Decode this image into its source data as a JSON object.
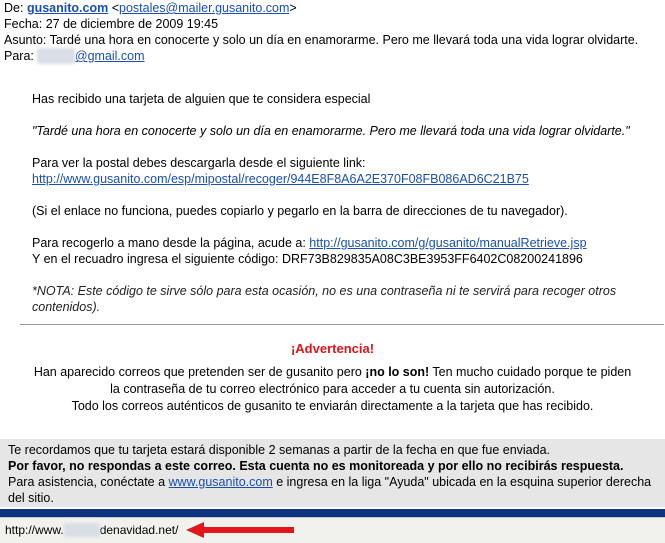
{
  "header": {
    "from_label": "De:",
    "from_name": "gusanito.com",
    "from_email": "postales@mailer.gusanito.com",
    "date_label": "Fecha:",
    "date": "27 de diciembre de 2009 19:45",
    "subject_label": "Asunto:",
    "subject": "Tardé una hora en conocerte y solo un día en enamorarme. Pero me llevará toda una vida lograr olvidarte.",
    "to_label": "Para:",
    "to_redacted": "xxxxxx",
    "to_domain": "@gmail.com"
  },
  "body": {
    "intro": "Has recibido una tarjeta de alguien que te considera especial",
    "quote": "\"Tardé una hora en conocerte y solo un día en enamorarme. Pero me llevará toda una vida lograr olvidarte.\"",
    "download_text": "Para ver la postal debes descargarla desde el siguiente link:",
    "postcard_link": "http://www.gusanito.com/esp/mipostal/recoger/944E8F8A6A2E370F08FB086AD6C21B75",
    "copy_hint": "(Si el enlace no funciona, puedes copiarlo y pegarlo en la barra de direcciones de tu navegador).",
    "manual_text": "Para recogerlo a mano desde la página, acude a:",
    "manual_link": "http://gusanito.com/g/gusanito/manualRetrieve.jsp",
    "code_text": "Y en el recuadro ingresa el siguiente código:",
    "code": "DRF73B829835A08C3BE3953FF6402C08200241896",
    "note": "*NOTA: Este código te sirve sólo para esta ocasión, no es una contraseña ni te servirá para recoger otros contenidos)."
  },
  "warning": {
    "title": "¡Advertencia!",
    "line1_pre": "Han aparecido correos que pretenden ser de gusanito pero",
    "line1_bold": "¡no lo son!",
    "line1_post": "Ten mucho cuidado porque te piden",
    "line2": "la contraseña de tu correo electrónico para acceder a tu cuenta sin autorización.",
    "line3": "Todo los correos auténticos de gusanito te enviarán directamente a la tarjeta que has recibido."
  },
  "footer": {
    "line1": "Te recordamos que tu tarjeta estará disponible 2 semanas a partir de la fecha en que fue enviada.",
    "line2": "Por favor, no respondas a este correo. Esta cuenta no es monitoreada y por ello no recibirás respuesta.",
    "line3_pre": "Para asistencia, conéctate a",
    "line3_link": "www.gusanito.com",
    "line3_post": "e ingresa en la liga \"Ayuda\" ubicada en la esquina superior derecha del sitio."
  },
  "status_bar": {
    "url_prefix": "http://www.",
    "url_redacted": "xxxxxx",
    "url_suffix": "denavidad.net/"
  },
  "colors": {
    "link": "#1a4fb0",
    "warning_title": "#e0141a",
    "arrow": "#e3161b",
    "blue_bar": "#0e3480"
  }
}
